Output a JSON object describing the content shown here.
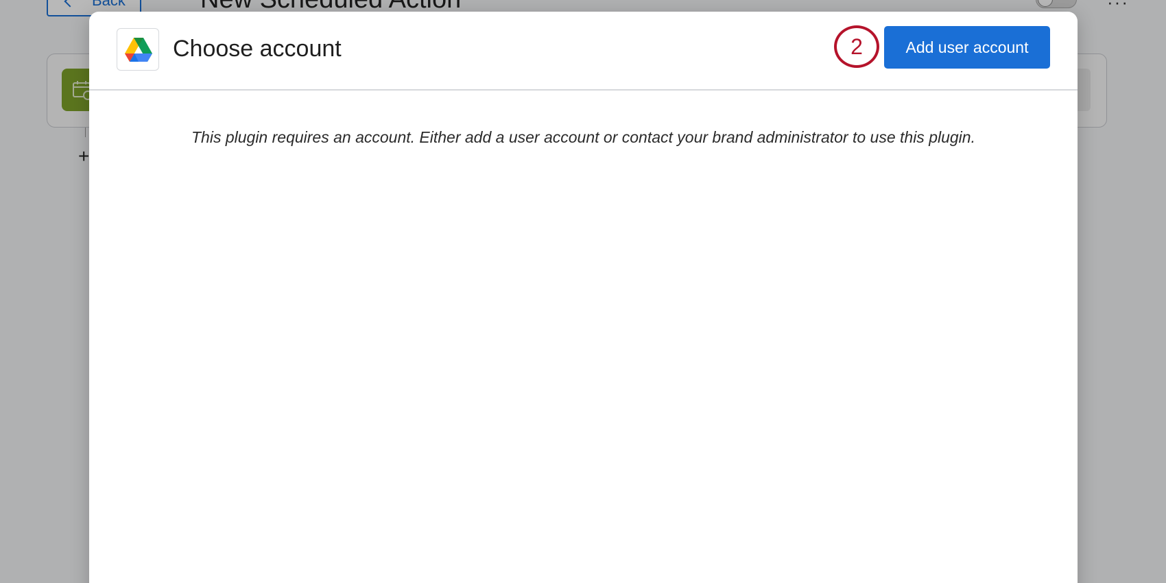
{
  "background": {
    "back_label": "Back",
    "page_title": "New Scheduled Action",
    "more_label": "···"
  },
  "modal": {
    "title": "Choose account",
    "step_number": "2",
    "add_button_label": "Add user account",
    "message": "This plugin requires an account. Either add a user account or contact your brand administrator to use this plugin."
  },
  "icons": {
    "app_logo": "google-drive-icon",
    "back": "chevron-left-icon",
    "card": "calendar-icon"
  },
  "colors": {
    "primary": "#1a6fd6",
    "step_badge": "#b5132b",
    "card_icon_bg": "#7fa32a"
  }
}
